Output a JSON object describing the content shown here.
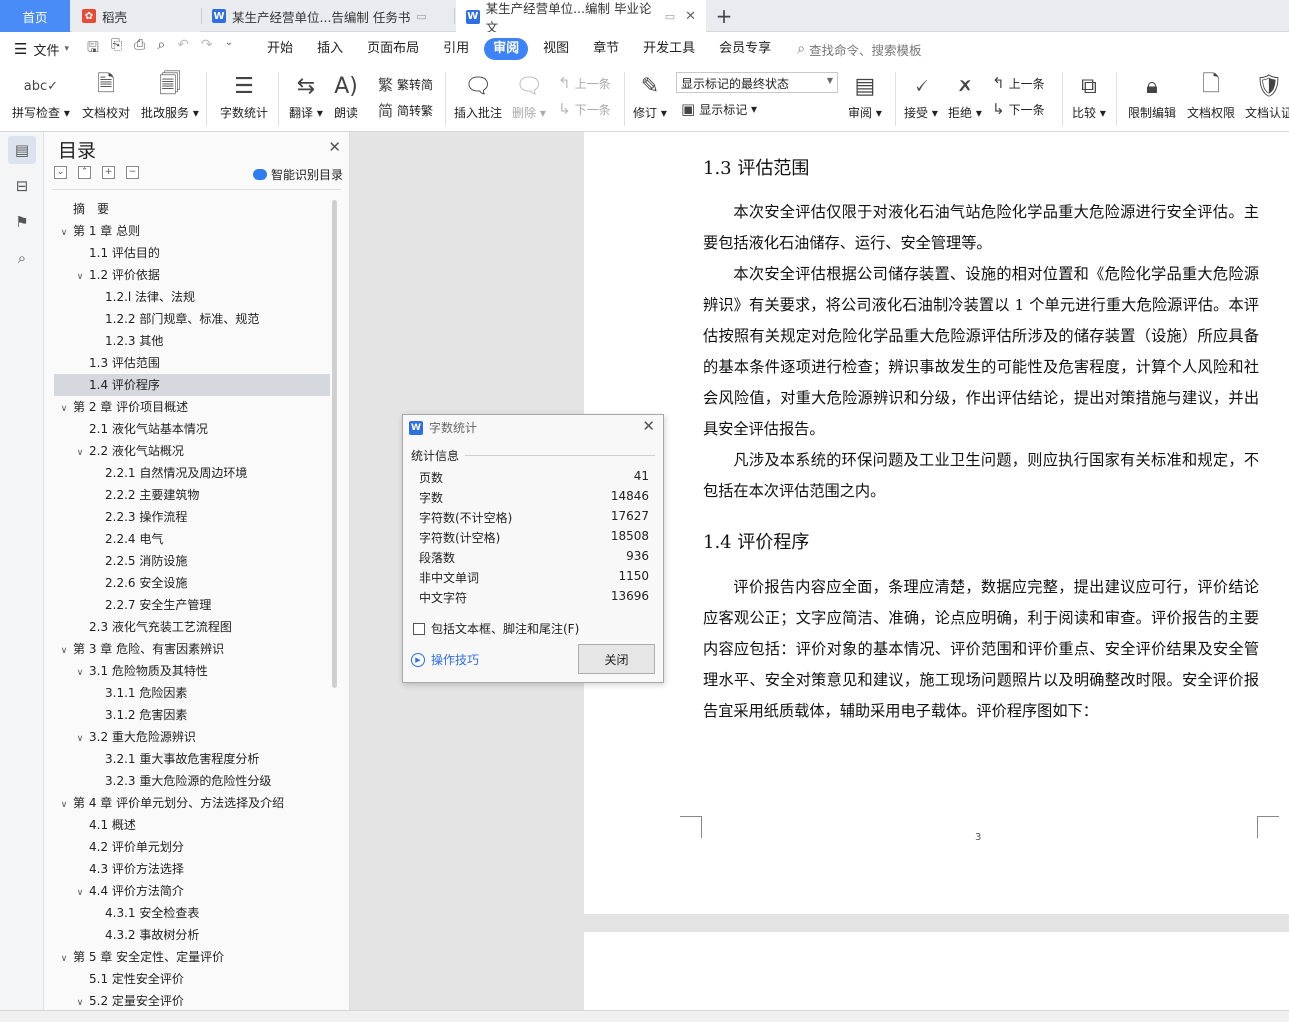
{
  "tabs": {
    "home": "首页",
    "daoke": "稻壳",
    "doc1": "某生产经营单位...告编制 任务书",
    "doc2": "某生产经营单位...编制 毕业论文",
    "new_tab": "+"
  },
  "menu": {
    "file": "文件",
    "items": [
      "开始",
      "插入",
      "页面布局",
      "引用",
      "审阅",
      "视图",
      "章节",
      "开发工具",
      "会员专享"
    ],
    "search_placeholder": "查找命令、搜索模板"
  },
  "ribbon": {
    "spell_check": "拼写检查",
    "doc_proof": "文档校对",
    "batch_service": "批改服务",
    "word_count": "字数统计",
    "translate": "翻译",
    "read_aloud": "朗读",
    "trad_simp": "繁转简",
    "simp_trad": "简转繁",
    "insert_comment": "插入批注",
    "delete": "删除",
    "prev_comment": "上一条",
    "next_comment": "下一条",
    "track_changes": "修订",
    "markup_state": "显示标记的最终状态",
    "show_markup": "显示标记",
    "review": "审阅",
    "accept": "接受",
    "reject": "拒绝",
    "prev_change": "上一条",
    "next_change": "下一条",
    "compare": "比较",
    "restrict_edit": "限制编辑",
    "doc_permission": "文档权限",
    "doc_cert": "文档认证"
  },
  "toc": {
    "title": "目录",
    "smart": "智能识别目录",
    "items": [
      {
        "label": "摘　要",
        "level": 1,
        "tw": ""
      },
      {
        "label": "第 1 章  总则",
        "level": 1,
        "tw": "∨"
      },
      {
        "label": "1.1 评估目的",
        "level": 2,
        "tw": ""
      },
      {
        "label": "1.2 评价依据",
        "level": 2,
        "tw": "∨"
      },
      {
        "label": "1.2.l  法律、法规",
        "level": 3,
        "tw": ""
      },
      {
        "label": "1.2.2  部门规章、标准、规范",
        "level": 3,
        "tw": ""
      },
      {
        "label": "1.2.3  其他",
        "level": 3,
        "tw": ""
      },
      {
        "label": "1.3 评估范围",
        "level": 2,
        "tw": ""
      },
      {
        "label": "1.4  评价程序",
        "level": 2,
        "tw": "",
        "selected": true
      },
      {
        "label": "第 2 章  评价项目概述",
        "level": 1,
        "tw": "∨"
      },
      {
        "label": "2.1  液化气站基本情况",
        "level": 2,
        "tw": ""
      },
      {
        "label": "2.2 液化气站概况",
        "level": 2,
        "tw": "∨"
      },
      {
        "label": "2.2.1 自然情况及周边环境",
        "level": 3,
        "tw": ""
      },
      {
        "label": "2.2.2 主要建筑物",
        "level": 3,
        "tw": ""
      },
      {
        "label": "2.2.3 操作流程",
        "level": 3,
        "tw": ""
      },
      {
        "label": "2.2.4 电气",
        "level": 3,
        "tw": ""
      },
      {
        "label": "2.2.5 消防设施",
        "level": 3,
        "tw": ""
      },
      {
        "label": "2.2.6 安全设施",
        "level": 3,
        "tw": ""
      },
      {
        "label": "2.2.7 安全生产管理",
        "level": 3,
        "tw": ""
      },
      {
        "label": "2.3  液化气充装工艺流程图",
        "level": 2,
        "tw": ""
      },
      {
        "label": "第 3 章  危险、有害因素辨识",
        "level": 1,
        "tw": "∨"
      },
      {
        "label": "3.1  危险物质及其特性",
        "level": 2,
        "tw": "∨"
      },
      {
        "label": "3.1.1 危险因素",
        "level": 3,
        "tw": ""
      },
      {
        "label": "3.1.2 危害因素",
        "level": 3,
        "tw": ""
      },
      {
        "label": "3.2 重大危险源辨识",
        "level": 2,
        "tw": "∨"
      },
      {
        "label": "3.2.1 重大事故危害程度分析",
        "level": 3,
        "tw": ""
      },
      {
        "label": "3.2.3 重大危险源的危险性分级",
        "level": 3,
        "tw": ""
      },
      {
        "label": "第 4 章  评价单元划分、方法选择及介绍",
        "level": 1,
        "tw": "∨"
      },
      {
        "label": "4.1  概述",
        "level": 2,
        "tw": ""
      },
      {
        "label": "4.2  评价单元划分",
        "level": 2,
        "tw": ""
      },
      {
        "label": "4.3  评价方法选择",
        "level": 2,
        "tw": ""
      },
      {
        "label": "4.4  评价方法简介",
        "level": 2,
        "tw": "∨"
      },
      {
        "label": "4.3.1  安全检查表",
        "level": 3,
        "tw": ""
      },
      {
        "label": "4.3.2  事故树分析",
        "level": 3,
        "tw": ""
      },
      {
        "label": "第 5 章  安全定性、定量评价",
        "level": 1,
        "tw": "∨"
      },
      {
        "label": "5.1 定性安全评价",
        "level": 2,
        "tw": ""
      },
      {
        "label": "5.2 定量安全评价",
        "level": 2,
        "tw": "∨"
      }
    ]
  },
  "document": {
    "h13": "1.3 评估范围",
    "p13": [
      "本次安全评估仅限于对液化石油气站危险化学品重大危险源进行安全评估。主要包括液化石油储存、运行、安全管理等。",
      "本次安全评估根据公司储存装置、设施的相对位置和《危险化学品重大危险源辨识》有关要求，将公司液化石油制冷装置以 1 个单元进行重大危险源评估。本评估按照有关规定对危险化学品重大危险源评估所涉及的储存装置（设施）所应具备的基本条件逐项进行检查；辨识事故发生的可能性及危害程度，计算个人风险和社会风险值，对重大危险源辨识和分级，作出评估结论，提出对策措施与建议，并出具安全评估报告。",
      "凡涉及本系统的环保问题及工业卫生问题，则应执行国家有关标准和规定，不包括在本次评估范围之内。"
    ],
    "h14": "1.4  评价程序",
    "p14": "评价报告内容应全面，条理应清楚，数据应完整，提出建议应可行，评价结论应客观公正；文字应简洁、准确，论点应明确，利于阅读和审查。评价报告的主要内容应包括：评价对象的基本情况、评价范围和评价重点、安全评价结果及安全管理水平、安全对策意见和建议，施工现场问题照片以及明确整改时限。安全评价报告宜采用纸质载体，辅助采用电子载体。评价程序图如下：",
    "page_number": "3"
  },
  "word_count_dialog": {
    "title": "字数统计",
    "section": "统计信息",
    "stats": [
      {
        "label": "页数",
        "value": "41"
      },
      {
        "label": "字数",
        "value": "14846"
      },
      {
        "label": "字符数(不计空格)",
        "value": "17627"
      },
      {
        "label": "字符数(计空格)",
        "value": "18508"
      },
      {
        "label": "段落数",
        "value": "936"
      },
      {
        "label": "非中文单词",
        "value": "1150"
      },
      {
        "label": "中文字符",
        "value": "13696"
      }
    ],
    "include_label": "包括文本框、脚注和尾注(F)",
    "tips": "操作技巧",
    "close": "关闭"
  }
}
